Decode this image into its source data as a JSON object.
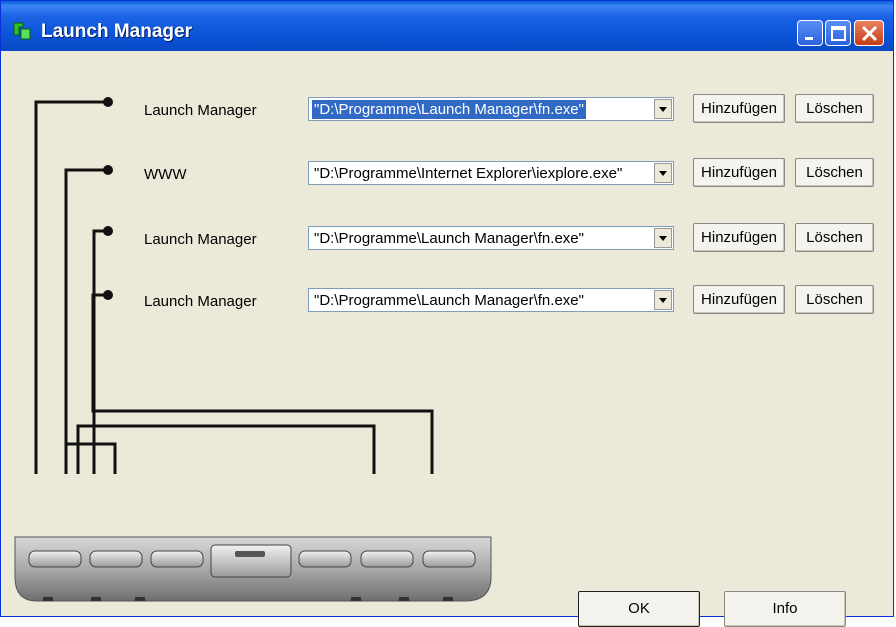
{
  "window": {
    "title": "Launch Manager"
  },
  "icons": {
    "app": "app-icon-green",
    "minimize": "minimize-icon",
    "maximize": "maximize-icon",
    "close": "close-icon",
    "dropdown": "chevron-down-icon"
  },
  "rows": [
    {
      "label": "Launch Manager",
      "value": "\"D:\\Programme\\Launch Manager\\fn.exe\"",
      "add_label": "Hinzufügen",
      "delete_label": "Löschen"
    },
    {
      "label": "WWW",
      "value": "\"D:\\Programme\\Internet Explorer\\iexplore.exe\"",
      "add_label": "Hinzufügen",
      "delete_label": "Löschen"
    },
    {
      "label": "Launch Manager",
      "value": "\"D:\\Programme\\Launch Manager\\fn.exe\"",
      "add_label": "Hinzufügen",
      "delete_label": "Löschen"
    },
    {
      "label": "Launch Manager",
      "value": "\"D:\\Programme\\Launch Manager\\fn.exe\"",
      "add_label": "Hinzufügen",
      "delete_label": "Löschen"
    }
  ],
  "footer": {
    "ok_label": "OK",
    "info_label": "Info"
  },
  "colors": {
    "titlebar": "#0954d6",
    "selection": "#316ac5",
    "face": "#ece9d8"
  }
}
